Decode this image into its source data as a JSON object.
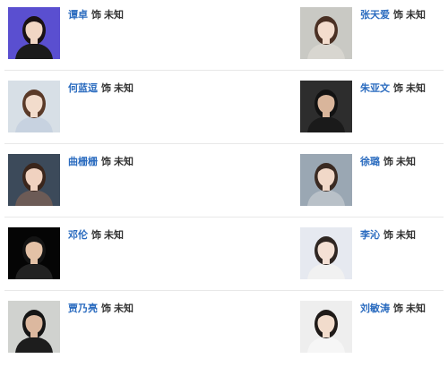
{
  "cast": [
    {
      "left": {
        "actor": "谭卓",
        "role_prefix": "饰",
        "role_name": "未知",
        "photo": {
          "bg": "#5a4fd0",
          "skin": "#f1d6c4",
          "hair": "#1a1214",
          "cloth": "#1b1b1b"
        }
      },
      "right": {
        "actor": "张天爱",
        "role_prefix": "饰",
        "role_name": "未知",
        "photo": {
          "bg": "#c9c9c4",
          "skin": "#f3dccd",
          "hair": "#4a3024",
          "cloth": "#d8d6d0"
        }
      }
    },
    {
      "left": {
        "actor": "何蓝逗",
        "role_prefix": "饰",
        "role_name": "未知",
        "photo": {
          "bg": "#d7dfe6",
          "skin": "#f2dccc",
          "hair": "#5a3a28",
          "cloth": "#c7d2e0"
        }
      },
      "right": {
        "actor": "朱亚文",
        "role_prefix": "饰",
        "role_name": "未知",
        "photo": {
          "bg": "#2d2d2d",
          "skin": "#d9b59b",
          "hair": "#121212",
          "cloth": "#1a1a1a"
        }
      }
    },
    {
      "left": {
        "actor": "曲栅栅",
        "role_prefix": "饰",
        "role_name": "未知",
        "photo": {
          "bg": "#3c4a5a",
          "skin": "#f0d2c0",
          "hair": "#3b261c",
          "cloth": "#6c5b56"
        }
      },
      "right": {
        "actor": "徐璐",
        "role_prefix": "饰",
        "role_name": "未知",
        "photo": {
          "bg": "#9aa7b3",
          "skin": "#f1d8c8",
          "hair": "#3a2a22",
          "cloth": "#b9c1c8"
        }
      }
    },
    {
      "left": {
        "actor": "邓伦",
        "role_prefix": "饰",
        "role_name": "未知",
        "photo": {
          "bg": "#050505",
          "skin": "#e3c1a6",
          "hair": "#141414",
          "cloth": "#222222"
        }
      },
      "right": {
        "actor": "李沁",
        "role_prefix": "饰",
        "role_name": "未知",
        "photo": {
          "bg": "#e6e9f0",
          "skin": "#f4e0d4",
          "hair": "#2f2622",
          "cloth": "#f1f1f1"
        }
      }
    },
    {
      "left": {
        "actor": "贾乃亮",
        "role_prefix": "饰",
        "role_name": "未知",
        "photo": {
          "bg": "#d0d2cf",
          "skin": "#dcb89f",
          "hair": "#151515",
          "cloth": "#1d1d1d"
        }
      },
      "right": {
        "actor": "刘敏涛",
        "role_prefix": "饰",
        "role_name": "未知",
        "photo": {
          "bg": "#eeeeee",
          "skin": "#f2dccc",
          "hair": "#1f1a18",
          "cloth": "#f6f6f6"
        }
      }
    }
  ]
}
